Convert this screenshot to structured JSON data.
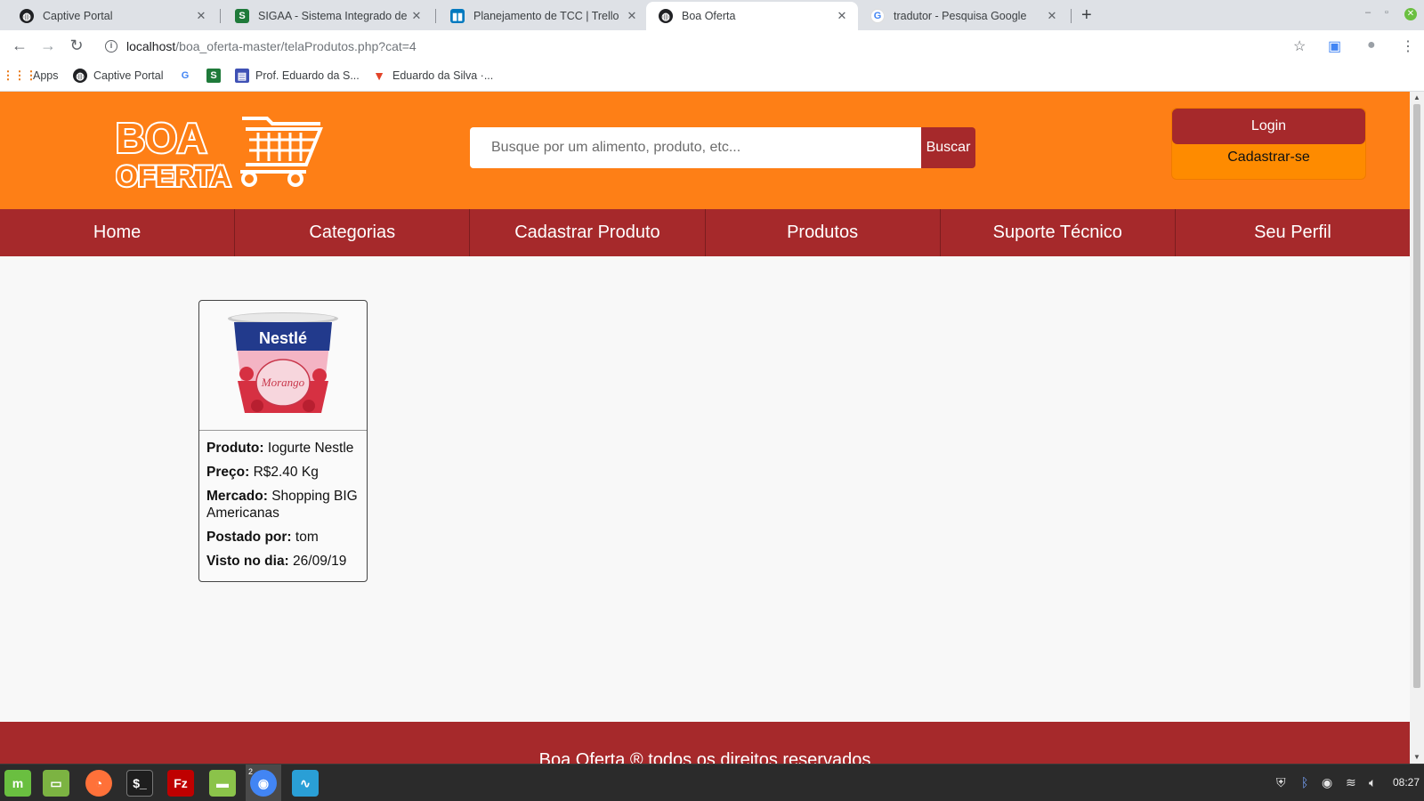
{
  "browser": {
    "tabs": [
      {
        "title": "Captive Portal",
        "icon": "globe-icon",
        "active": false
      },
      {
        "title": "SIGAA - Sistema Integrado de G",
        "icon": "sigaa-icon",
        "active": false
      },
      {
        "title": "Planejamento de TCC | Trello",
        "icon": "trello-icon",
        "active": false
      },
      {
        "title": "Boa Oferta",
        "icon": "globe-icon",
        "active": true
      },
      {
        "title": "tradutor - Pesquisa Google",
        "icon": "google-icon",
        "active": false
      }
    ],
    "url_host": "localhost",
    "url_path": "/boa_oferta-master/telaProdutos.php?cat=4",
    "bookmarks": [
      {
        "label": "Apps",
        "icon": "apps-grid-icon"
      },
      {
        "label": "Captive Portal",
        "icon": "globe-icon"
      },
      {
        "label": "",
        "icon": "google-icon"
      },
      {
        "label": "",
        "icon": "sigaa-icon"
      },
      {
        "label": "Prof. Eduardo da S...",
        "icon": "bookmark-page-icon"
      },
      {
        "label": "Eduardo da Silva ·...",
        "icon": "gitlab-icon"
      }
    ]
  },
  "site": {
    "logo_line1": "BOA",
    "logo_line2": "OFERTA",
    "search": {
      "placeholder": "Busque por um alimento, produto, etc...",
      "button": "Buscar"
    },
    "auth": {
      "login": "Login",
      "signup": "Cadastrar-se"
    },
    "nav": [
      "Home",
      "Categorias",
      "Cadastrar Produto",
      "Produtos",
      "Suporte Técnico",
      "Seu Perfil"
    ],
    "product": {
      "image_brand": "Nestlé",
      "image_flavor": "Morango",
      "fields": [
        {
          "label": "Produto:",
          "value": "Iogurte Nestle"
        },
        {
          "label": "Preço:",
          "value": "R$2.40 Kg"
        },
        {
          "label": "Mercado:",
          "value": "Shopping BIG Americanas"
        },
        {
          "label": "Postado por:",
          "value": "tom"
        },
        {
          "label": "Visto no dia:",
          "value": "26/09/19"
        }
      ]
    },
    "footer": "Boa Oferta ® todos os direitos reservados"
  },
  "taskbar": {
    "clock": "08:27",
    "chrome_window_count": "2"
  },
  "colors": {
    "header_orange": "#fe7f16",
    "brand_red": "#a6292b",
    "auth_orange": "#fe8b00"
  }
}
